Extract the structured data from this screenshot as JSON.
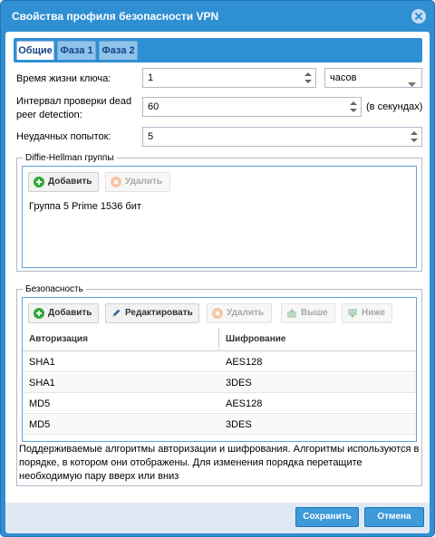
{
  "dialog": {
    "title": "Свойства профиля безопасности VPN",
    "close_icon": "close-icon"
  },
  "tabs": [
    {
      "label": "Общие",
      "active": true
    },
    {
      "label": "Фаза 1",
      "active": false
    },
    {
      "label": "Фаза 2",
      "active": false
    }
  ],
  "form": {
    "key_lifetime": {
      "label": "Время жизни ключа:",
      "value": "1",
      "unit": "часов"
    },
    "dpd_interval": {
      "label_line1": "Интервал проверки dead",
      "label_line2": "peer detection:",
      "value": "60",
      "unit": "(в секундах)"
    },
    "failed_attempts": {
      "label": "Неудачных попыток:",
      "value": "5"
    }
  },
  "dh_groups": {
    "legend": "Diffie-Hellman группы",
    "add_label": "Добавить",
    "delete_label": "Удалить",
    "items": [
      "Группа 5 Prime 1536 бит"
    ]
  },
  "security": {
    "legend": "Безопасность",
    "toolbar": {
      "add": "Добавить",
      "edit": "Редактировать",
      "delete": "Удалить",
      "up": "Выше",
      "down": "Ниже"
    },
    "columns": [
      "Авторизация",
      "Шифрование"
    ],
    "rows": [
      {
        "auth": "SHA1",
        "enc": "AES128"
      },
      {
        "auth": "SHA1",
        "enc": "3DES"
      },
      {
        "auth": "MD5",
        "enc": "AES128"
      },
      {
        "auth": "MD5",
        "enc": "3DES"
      }
    ],
    "note": "Поддерживаемые алгоритмы авторизации и шифрования. Алгоритмы используются в порядке, в котором они отображены. Для изменения порядка перетащите необходимую пару вверх или вниз"
  },
  "footer": {
    "save": "Сохранить",
    "cancel": "Отмена"
  },
  "colors": {
    "accent": "#2f8fd3",
    "add_green": "#2ea836",
    "delete_orange": "#f08a4b"
  }
}
